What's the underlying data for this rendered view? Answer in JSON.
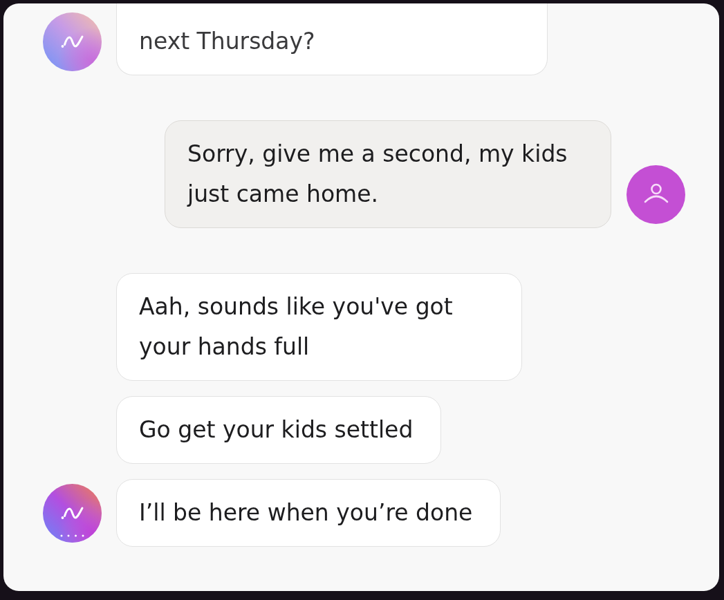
{
  "chat": {
    "groups": [
      {
        "kind": "bot",
        "avatar": {
          "active": false
        },
        "messages": [
          {
            "text": "next Thursday?"
          }
        ]
      },
      {
        "kind": "user",
        "messages": [
          {
            "text": "Sorry, give me a second, my kids just came home."
          }
        ]
      },
      {
        "kind": "bot",
        "avatar": {
          "active": true
        },
        "messages": [
          {
            "text": "Aah, sounds like you've got your hands full"
          },
          {
            "text": "Go get your kids settled"
          },
          {
            "text": "I’ll be here when you’re done"
          }
        ]
      }
    ]
  }
}
